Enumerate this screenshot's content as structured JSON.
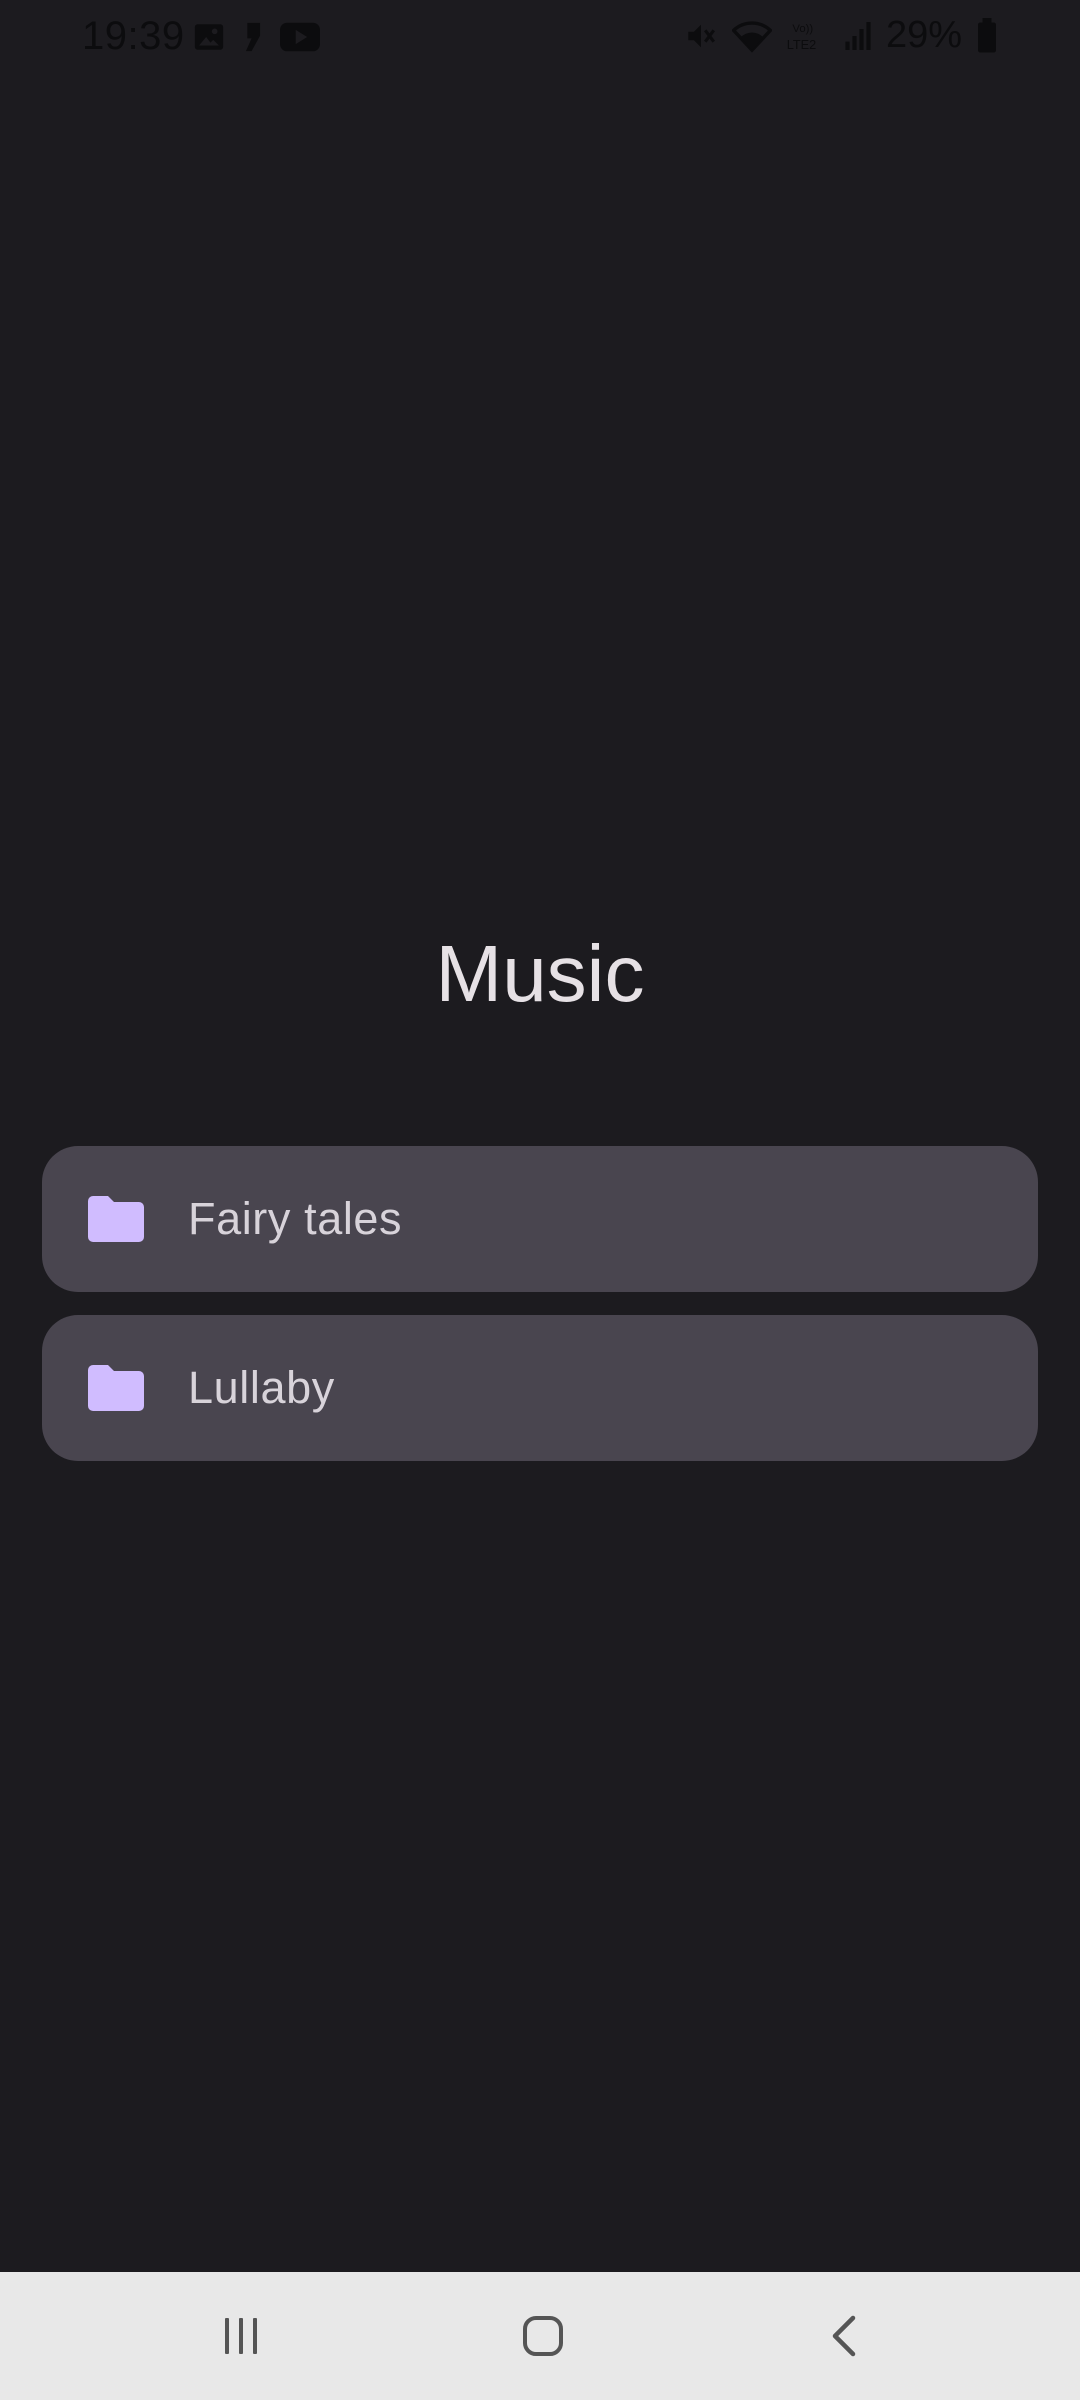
{
  "status_bar": {
    "time": "19:39",
    "battery": "29%",
    "left_icons": [
      "image-icon",
      "quote-notification-icon",
      "youtube-icon"
    ],
    "right_icons": [
      "mute-icon",
      "wifi-icon",
      "volte-lte2-icon",
      "signal-icon",
      "battery-icon"
    ]
  },
  "page": {
    "title": "Music"
  },
  "folders": [
    {
      "label": "Fairy tales",
      "icon": "folder-icon"
    },
    {
      "label": "Lullaby",
      "icon": "folder-icon"
    }
  ],
  "nav_bar": {
    "buttons": [
      "recent-apps-icon",
      "home-icon",
      "back-icon"
    ]
  },
  "colors": {
    "background": "#1c1b1f",
    "card": "#49454f",
    "folder_accent": "#d0bcff",
    "title": "#e6e1e5",
    "nav_bar": "#e8e8e8"
  }
}
